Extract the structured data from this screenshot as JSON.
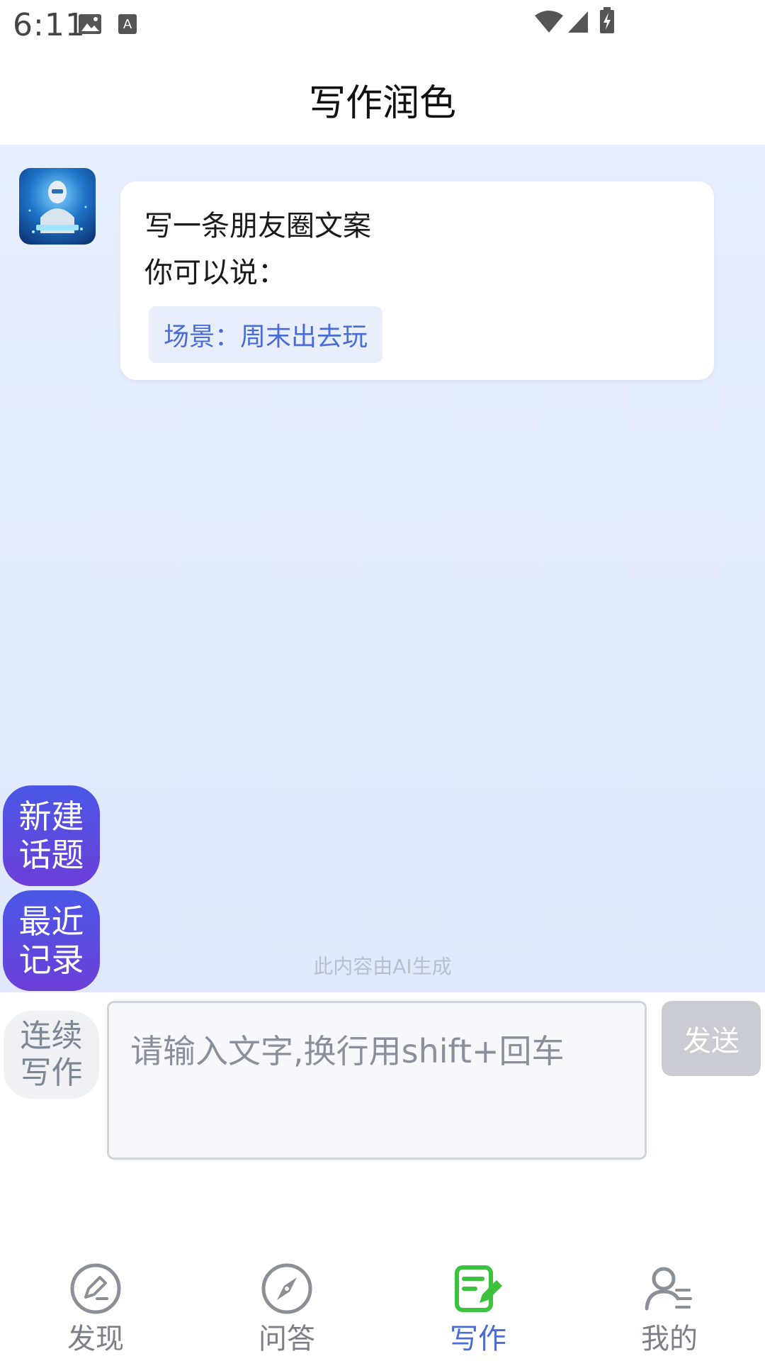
{
  "status_bar": {
    "time": "6:11",
    "icons": [
      "image-icon",
      "a-keyboard-icon",
      "wifi-icon",
      "signal-icon",
      "battery-charging-icon"
    ]
  },
  "header": {
    "title": "写作润色"
  },
  "chat": {
    "bot_avatar": "robot-avatar",
    "message": {
      "line1": "写一条朋友圈文案",
      "line2": "你可以说：",
      "suggestion": "场景：周末出去玩"
    },
    "ai_notice": "此内容由AI生成"
  },
  "floating_buttons": {
    "new_topic": "新建话题",
    "recent_records": "最近记录"
  },
  "input": {
    "continue_label": "连续写作",
    "placeholder": "请输入文字,换行用shift+回车",
    "value": "",
    "send_label": "发送"
  },
  "bottom_nav": {
    "items": [
      {
        "label": "发现",
        "icon": "edit-circle-icon",
        "active": false
      },
      {
        "label": "问答",
        "icon": "compass-icon",
        "active": false
      },
      {
        "label": "写作",
        "icon": "notepad-write-icon",
        "active": true
      },
      {
        "label": "我的",
        "icon": "user-icon",
        "active": false
      }
    ]
  },
  "colors": {
    "accent": "#4a6cd6",
    "active_icon": "#3cc23c",
    "float_button_top": "#4a57e6",
    "float_button_bottom": "#6c3fd8",
    "chat_background": "#e4edfd",
    "send_disabled": "#c9ccd2"
  }
}
